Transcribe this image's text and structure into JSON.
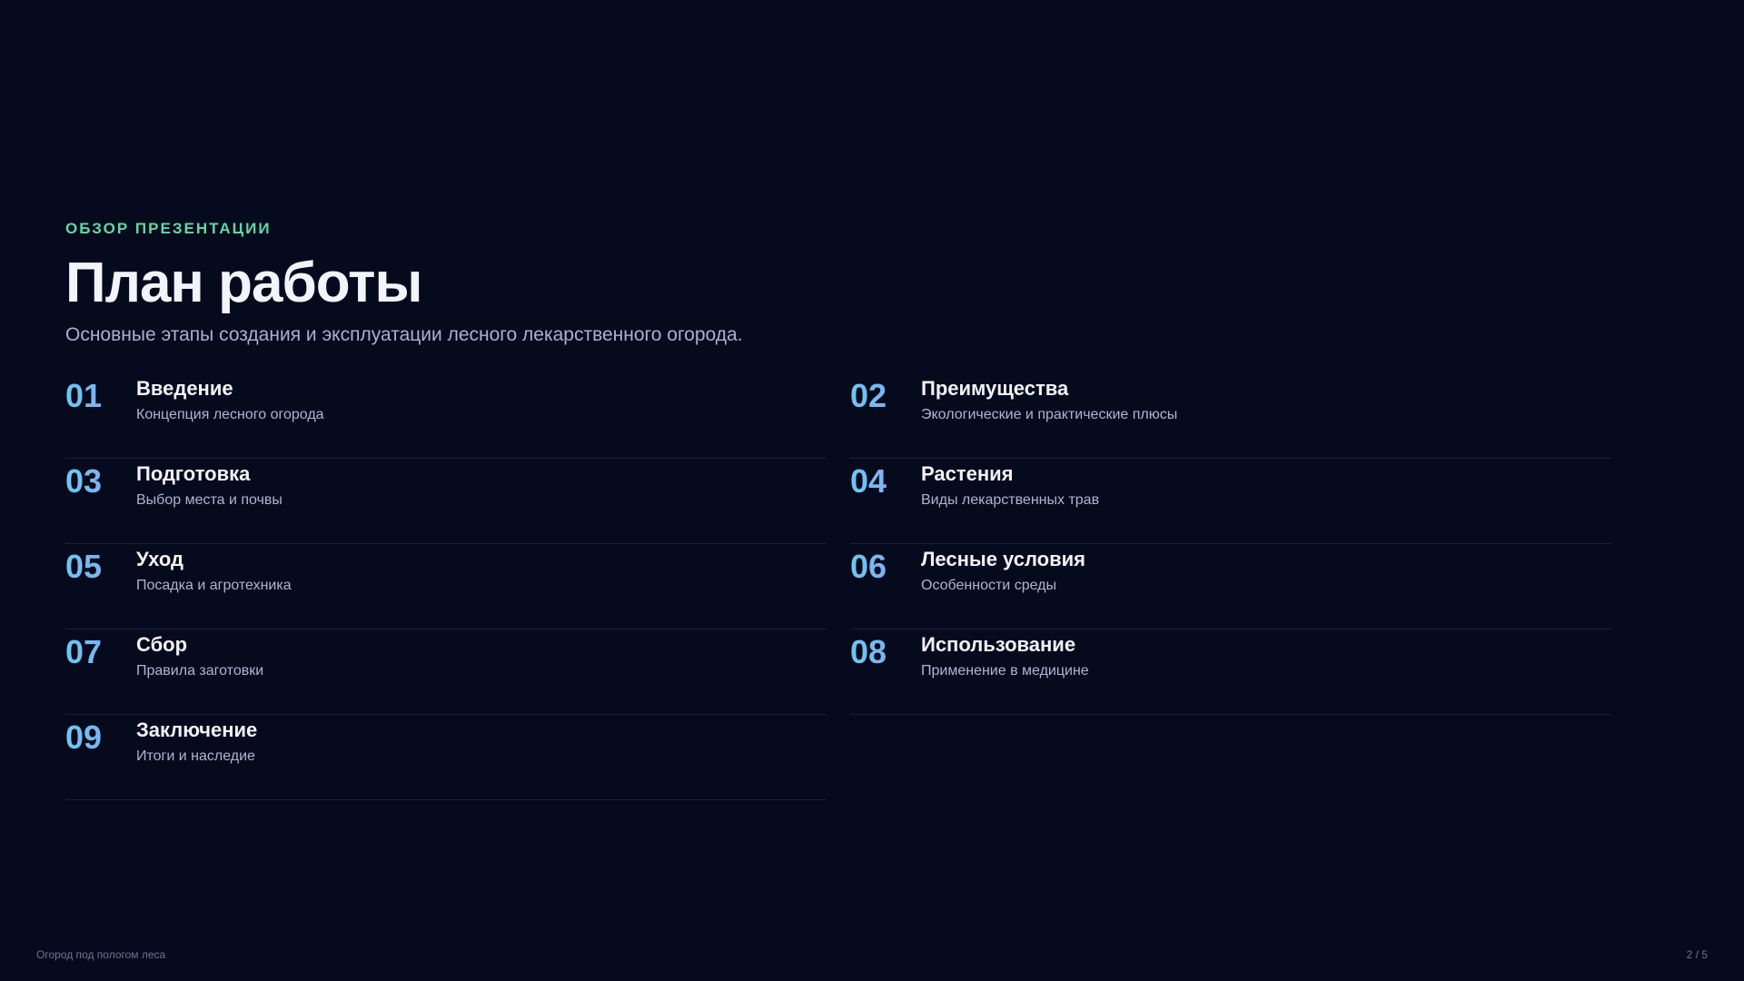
{
  "header": {
    "eyebrow": "ОБЗОР ПРЕЗЕНТАЦИИ",
    "title": "План работы",
    "subtitle": "Основные этапы создания и эксплуатации лесного лекарственного огорода."
  },
  "agenda": [
    {
      "num": "01",
      "title": "Введение",
      "subtitle": "Концепция лесного огорода"
    },
    {
      "num": "02",
      "title": "Преимущества",
      "subtitle": "Экологические и практические плюсы"
    },
    {
      "num": "03",
      "title": "Подготовка",
      "subtitle": "Выбор места и почвы"
    },
    {
      "num": "04",
      "title": "Растения",
      "subtitle": "Виды лекарственных трав"
    },
    {
      "num": "05",
      "title": "Уход",
      "subtitle": "Посадка и агротехника"
    },
    {
      "num": "06",
      "title": "Лесные условия",
      "subtitle": "Особенности среды"
    },
    {
      "num": "07",
      "title": "Сбор",
      "subtitle": "Правила заготовки"
    },
    {
      "num": "08",
      "title": "Использование",
      "subtitle": "Применение в медицине"
    },
    {
      "num": "09",
      "title": "Заключение",
      "subtitle": "Итоги и наследие"
    }
  ],
  "footer": {
    "left": "Огород под пологом леса",
    "right": "2 / 5"
  },
  "colors": {
    "background": "#060a1d",
    "accent": "#5fd9a6",
    "number_gradient_start": "#6cc8f0",
    "number_gradient_end": "#8f9cf5"
  }
}
